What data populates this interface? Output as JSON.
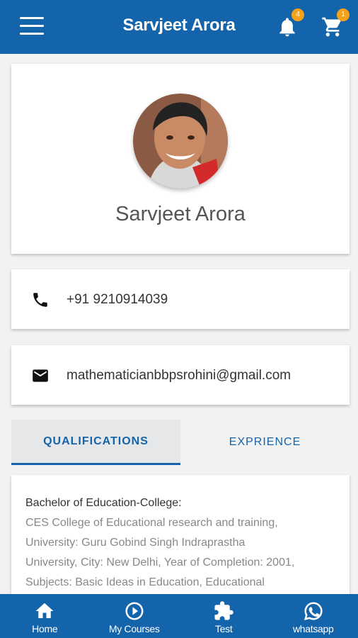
{
  "header": {
    "title": "Sarvjeet Arora",
    "menu_icon": "hamburger-icon",
    "notifications": {
      "icon": "bell-icon",
      "count": "4",
      "badge_color": "#f3a21a"
    },
    "cart": {
      "icon": "cart-icon",
      "count": "1",
      "badge_color": "#f3a21a"
    }
  },
  "profile": {
    "name": "Sarvjeet Arora",
    "avatar": "teacher-avatar"
  },
  "contact": {
    "phone": {
      "icon": "phone-icon",
      "value": "+91 9210914039"
    },
    "email": {
      "icon": "email-icon",
      "value": "mathematicianbbpsrohini@gmail.com"
    }
  },
  "tabs": [
    {
      "label": "QUALIFICATIONS",
      "active": true
    },
    {
      "label": "EXPRIENCE",
      "active": false
    }
  ],
  "qualification": {
    "title": "Bachelor of Education-College:",
    "lines": [
      "CES College of Educational research and training,",
      "University: Guru Gobind Singh Indraprastha",
      "University, City: New Delhi, Year of Completion: 2001,",
      "Subjects: Basic Ideas in Education, Educational"
    ]
  },
  "bottom_nav": [
    {
      "label": "Home",
      "icon": "home-icon"
    },
    {
      "label": "My Courses",
      "icon": "play-circle-icon"
    },
    {
      "label": "Test",
      "icon": "puzzle-icon"
    },
    {
      "label": "whatsapp",
      "icon": "whatsapp-icon"
    }
  ],
  "colors": {
    "primary": "#1464ac",
    "badge": "#f3a21a",
    "background": "#f2f2f2"
  }
}
